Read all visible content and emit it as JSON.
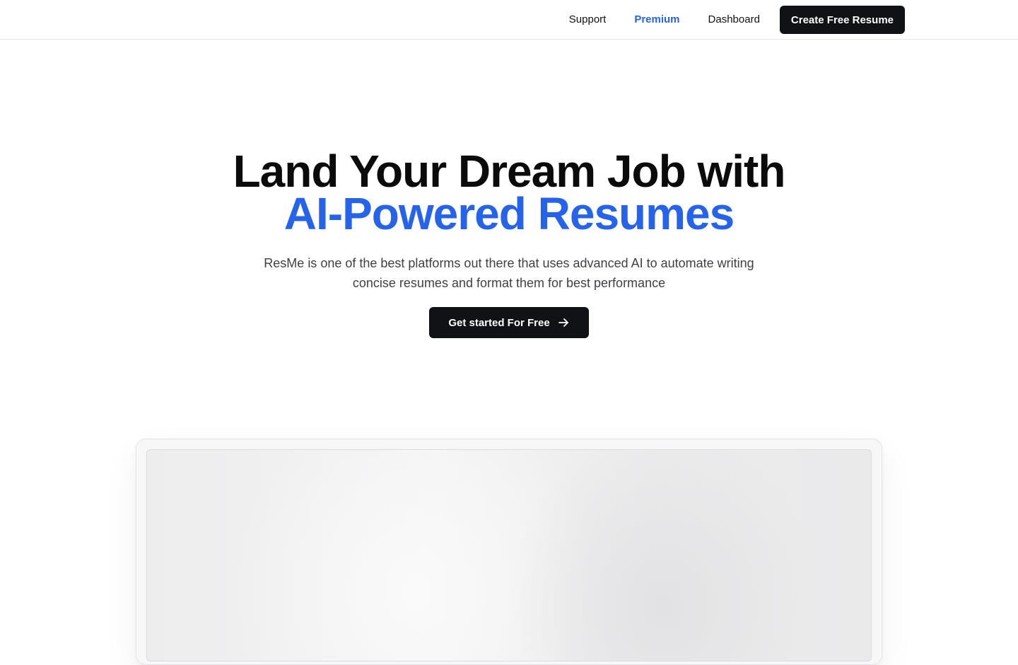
{
  "nav": {
    "links": [
      {
        "label": "Support",
        "active": false
      },
      {
        "label": "Premium",
        "active": true
      },
      {
        "label": "Dashboard",
        "active": false
      }
    ],
    "cta_label": "Create Free Resume"
  },
  "hero": {
    "title_line1": "Land Your Dream Job with",
    "title_line2": "AI-Powered Resumes",
    "subtitle": "ResMe is one of the best platforms out there that uses advanced AI to automate writing concise resumes and format them for best performance",
    "button_label": "Get started For Free",
    "button_icon": "arrow-right-icon"
  },
  "colors": {
    "accent": "#2563eb",
    "button_bg": "#111216",
    "text": "#0b0b0b"
  }
}
